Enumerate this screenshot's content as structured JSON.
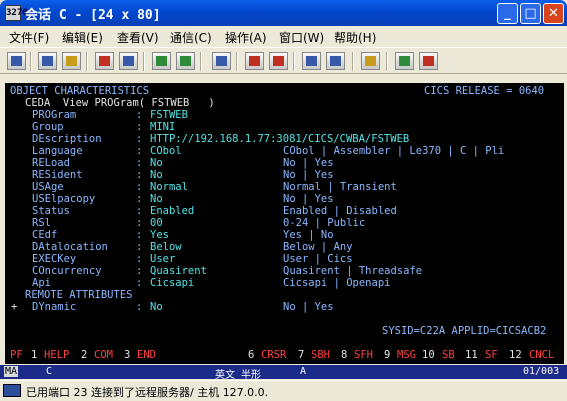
{
  "window": {
    "icon_label": "3270",
    "title": "会话 C - [24 x 80]",
    "buttons": {
      "minimize": "_",
      "maximize": "□",
      "close": "✕"
    }
  },
  "menu": [
    "文件(F)",
    "编辑(E)",
    "查看(V)",
    "通信(C)",
    "操作(A)",
    "窗口(W)",
    "帮助(H)"
  ],
  "toolbar": {
    "icons": [
      "open-session-icon",
      "copy-icon",
      "paste-icon",
      "send-file-icon",
      "receive-file-icon",
      "display-setup-icon",
      "keyboard-map-icon",
      "print-icon",
      "macro-record-icon",
      "macro-play-icon",
      "macro-stop-icon",
      "macro-pause-icon",
      "clipboard-icon",
      "globe-icon",
      "help-icon"
    ]
  },
  "terminal": {
    "line1_left": "OBJECT CHARACTERISTICS",
    "line1_right": "CICS RELEASE = 0640",
    "cmd_line": "CEDA  View PROGram( FSTWEB   )",
    "attributes": [
      {
        "name": "PROGram",
        "value": "FSTWEB",
        "options": ""
      },
      {
        "name": "Group",
        "value": "MINI",
        "options": ""
      },
      {
        "name": "DEscription",
        "value": "HTTP://192.168.1.77:3081/CICS/CWBA/FSTWEB",
        "options": ""
      },
      {
        "name": "Language",
        "value": "CObol",
        "options": "CObol | Assembler | Le370 | C | Pli"
      },
      {
        "name": "RELoad",
        "value": "No",
        "options": "No | Yes"
      },
      {
        "name": "RESident",
        "value": "No",
        "options": "No | Yes"
      },
      {
        "name": "USAge",
        "value": "Normal",
        "options": "Normal | Transient"
      },
      {
        "name": "USElpacopy",
        "value": "No",
        "options": "No | Yes"
      },
      {
        "name": "Status",
        "value": "Enabled",
        "options": "Enabled | Disabled"
      },
      {
        "name": "RSl",
        "value": "00",
        "options": "0-24 | Public"
      },
      {
        "name": "CEdf",
        "value": "Yes",
        "options": "Yes | No"
      },
      {
        "name": "DAtalocation",
        "value": "Below",
        "options": "Below | Any"
      },
      {
        "name": "EXECKey",
        "value": "User",
        "options": "User | Cics"
      },
      {
        "name": "COncurrency",
        "value": "Quasirent",
        "options": "Quasirent | Threadsafe"
      },
      {
        "name": "Api",
        "value": "Cicsapi",
        "options": "Cicsapi | Openapi"
      }
    ],
    "section": "REMOTE ATTRIBUTES",
    "remote": {
      "marker": "+",
      "name": "DYnamic",
      "value": "No",
      "options": "No | Yes"
    },
    "sysid_line": "SYSID=C22A APPLID=CICSACB2",
    "pfkeys": [
      {
        "num": "PF",
        "label": ""
      },
      {
        "num": "1",
        "label": "HELP"
      },
      {
        "num": "2",
        "label": "COM"
      },
      {
        "num": "3",
        "label": "END"
      },
      {
        "num": "6",
        "label": "CRSR"
      },
      {
        "num": "7",
        "label": "SBH"
      },
      {
        "num": "8",
        "label": "SFH"
      },
      {
        "num": "9",
        "label": "MSG"
      },
      {
        "num": "10",
        "label": "SB"
      },
      {
        "num": "11",
        "label": "SF"
      },
      {
        "num": "12",
        "label": "CNCL"
      }
    ]
  },
  "oia": {
    "left": "MA",
    "session": "C",
    "input_mode": "英文 半形",
    "indicator": "A",
    "cursor": "01/003"
  },
  "status": {
    "message": "已用端口 23 连接到了远程服务器/ 主机 127.0.0."
  },
  "colors": {
    "screen_bg": "#000000",
    "label": "#8ab8ff",
    "value": "#52e4e8",
    "pf_key": "#ff4040",
    "title_bar": "#0347cf"
  }
}
